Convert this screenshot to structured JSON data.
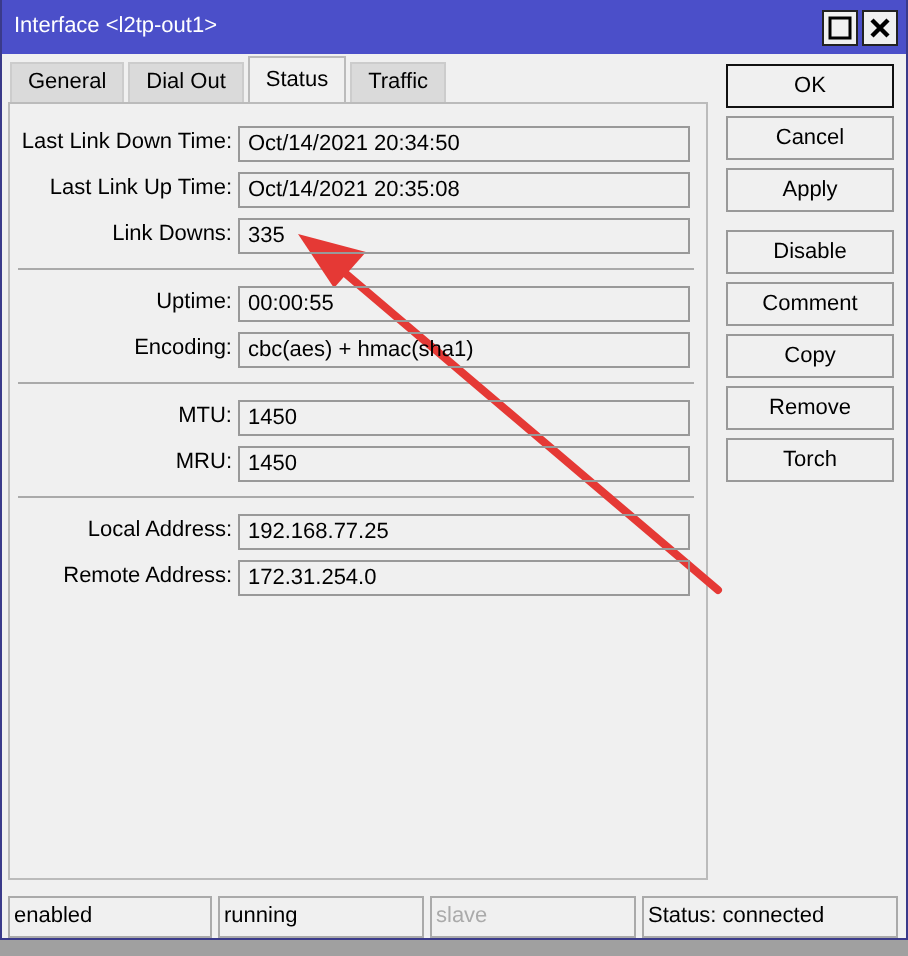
{
  "window": {
    "title": "Interface <l2tp-out1>"
  },
  "tabs": [
    {
      "label": "General",
      "selected": false
    },
    {
      "label": "Dial Out",
      "selected": false
    },
    {
      "label": "Status",
      "selected": true
    },
    {
      "label": "Traffic",
      "selected": false
    }
  ],
  "field_groups": [
    [
      {
        "label": "Last Link Down Time:",
        "value": "Oct/14/2021 20:34:50"
      },
      {
        "label": "Last Link Up Time:",
        "value": "Oct/14/2021 20:35:08"
      },
      {
        "label": "Link Downs:",
        "value": "335"
      }
    ],
    [
      {
        "label": "Uptime:",
        "value": "00:00:55"
      },
      {
        "label": "Encoding:",
        "value": "cbc(aes) + hmac(sha1)"
      }
    ],
    [
      {
        "label": "MTU:",
        "value": "1450"
      },
      {
        "label": "MRU:",
        "value": "1450"
      }
    ],
    [
      {
        "label": "Local Address:",
        "value": "192.168.77.25"
      },
      {
        "label": "Remote Address:",
        "value": "172.31.254.0"
      }
    ]
  ],
  "button_groups": [
    [
      {
        "label": "OK",
        "default": true
      },
      {
        "label": "Cancel",
        "default": false
      },
      {
        "label": "Apply",
        "default": false
      }
    ],
    [
      {
        "label": "Disable",
        "default": false
      },
      {
        "label": "Comment",
        "default": false
      },
      {
        "label": "Copy",
        "default": false
      },
      {
        "label": "Remove",
        "default": false
      },
      {
        "label": "Torch",
        "default": false
      }
    ]
  ],
  "status_bar": [
    {
      "text": "enabled",
      "disabled": false
    },
    {
      "text": "running",
      "disabled": false
    },
    {
      "text": "slave",
      "disabled": true
    },
    {
      "text": "Status: connected",
      "disabled": false
    }
  ],
  "annotations": [
    {
      "kind": "arrow"
    }
  ]
}
